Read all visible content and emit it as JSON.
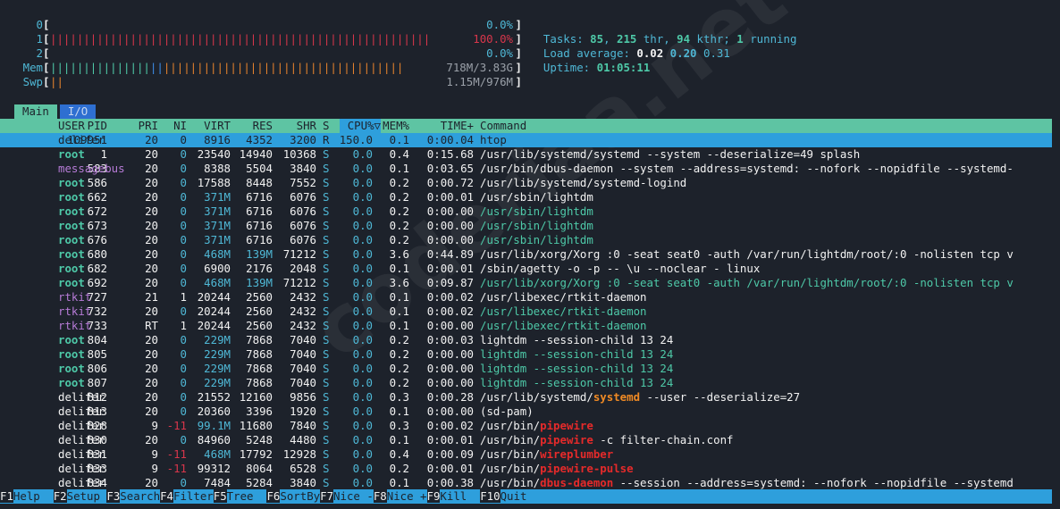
{
  "meters": [
    {
      "label": "0",
      "bars": "",
      "value": "0.0%",
      "value_color": "cyan"
    },
    {
      "label": "1",
      "bars": "|||||||||||||||||||||||||||||||||||||||||||||||||||||||||",
      "value": "100.0%",
      "value_color": "red",
      "bar_color": "#d8364b"
    },
    {
      "label": "2",
      "bars": "",
      "value": "0.0%",
      "value_color": "cyan"
    },
    {
      "label": "Mem",
      "bars": "||||||||||||||| ||||||||||||||||||||||||||||||||||||",
      "value": "718M/3.83G",
      "value_color": "gray",
      "bar_color": "#4ec9a8"
    },
    {
      "label": "Swp",
      "bars": "||",
      "value": "1.15M/976M",
      "value_color": "gray",
      "bar_color": "#e4822d"
    }
  ],
  "stats": {
    "tasks_label": "Tasks: ",
    "tasks": "85",
    "sep1": ", ",
    "thr": "215",
    "thr_label": " thr, ",
    "kthr": "94",
    "kthr_label": " kthr; ",
    "running": "1",
    "running_label": " running",
    "load_label": "Load average: ",
    "load1": "0.02",
    "load5": "0.20",
    "load15": "0.31",
    "uptime_label": "Uptime: ",
    "uptime": "01:05:11"
  },
  "tabs": {
    "main": "Main",
    "io": "I/O"
  },
  "columns": {
    "pid": "PID",
    "user": "USER",
    "pri": "PRI",
    "ni": "NI",
    "virt": "VIRT",
    "res": "RES",
    "shr": "SHR",
    "s": "S",
    "cpu": "CPU%▽",
    "mem": "MEM%",
    "time": "TIME+",
    "cmd": "Command"
  },
  "processes": [
    {
      "pid": "109951",
      "user": "delifer",
      "pri": "20",
      "ni": "0",
      "virt": "8916",
      "res": "4352",
      "shr": "3200",
      "s": "R",
      "cpu": "150.0",
      "mem": "0.1",
      "time": "0:00.04",
      "cmd": "htop",
      "selected": true
    },
    {
      "pid": "1",
      "user": "root",
      "pri": "20",
      "ni": "0",
      "virt": "23540",
      "res": "14940",
      "shr": "10368",
      "s": "S",
      "cpu": "0.0",
      "mem": "0.4",
      "time": "0:15.68",
      "cmd": "/usr/lib/systemd/systemd --system --deserialize=49 splash"
    },
    {
      "pid": "583",
      "user": "messagebus",
      "pri": "20",
      "ni": "0",
      "virt": "8388",
      "res": "5504",
      "shr": "3840",
      "s": "S",
      "cpu": "0.0",
      "mem": "0.1",
      "time": "0:03.65",
      "cmd": "/usr/bin/dbus-daemon --system --address=systemd: --nofork --nopidfile --systemd-"
    },
    {
      "pid": "586",
      "user": "root",
      "pri": "20",
      "ni": "0",
      "virt": "17588",
      "res": "8448",
      "shr": "7552",
      "s": "S",
      "cpu": "0.0",
      "mem": "0.2",
      "time": "0:00.72",
      "cmd": "/usr/lib/systemd/systemd-logind"
    },
    {
      "pid": "662",
      "user": "root",
      "pri": "20",
      "ni": "0",
      "virt": "371M",
      "res": "6716",
      "shr": "6076",
      "s": "S",
      "cpu": "0.0",
      "mem": "0.2",
      "time": "0:00.01",
      "cmd": "/usr/sbin/lightdm"
    },
    {
      "pid": "672",
      "user": "root",
      "pri": "20",
      "ni": "0",
      "virt": "371M",
      "res": "6716",
      "shr": "6076",
      "s": "S",
      "cpu": "0.0",
      "mem": "0.2",
      "time": "0:00.00",
      "cmd": "/usr/sbin/lightdm",
      "thread": true
    },
    {
      "pid": "673",
      "user": "root",
      "pri": "20",
      "ni": "0",
      "virt": "371M",
      "res": "6716",
      "shr": "6076",
      "s": "S",
      "cpu": "0.0",
      "mem": "0.2",
      "time": "0:00.00",
      "cmd": "/usr/sbin/lightdm",
      "thread": true
    },
    {
      "pid": "676",
      "user": "root",
      "pri": "20",
      "ni": "0",
      "virt": "371M",
      "res": "6716",
      "shr": "6076",
      "s": "S",
      "cpu": "0.0",
      "mem": "0.2",
      "time": "0:00.00",
      "cmd": "/usr/sbin/lightdm",
      "thread": true
    },
    {
      "pid": "680",
      "user": "root",
      "pri": "20",
      "ni": "0",
      "virt": "468M",
      "res": "139M",
      "shr": "71212",
      "s": "S",
      "cpu": "0.0",
      "mem": "3.6",
      "time": "0:44.89",
      "cmd": "/usr/lib/xorg/Xorg :0 -seat seat0 -auth /var/run/lightdm/root/:0 -nolisten tcp v"
    },
    {
      "pid": "682",
      "user": "root",
      "pri": "20",
      "ni": "0",
      "virt": "6900",
      "res": "2176",
      "shr": "2048",
      "s": "S",
      "cpu": "0.0",
      "mem": "0.1",
      "time": "0:00.01",
      "cmd": "/sbin/agetty -o -p -- \\u --noclear - linux"
    },
    {
      "pid": "692",
      "user": "root",
      "pri": "20",
      "ni": "0",
      "virt": "468M",
      "res": "139M",
      "shr": "71212",
      "s": "S",
      "cpu": "0.0",
      "mem": "3.6",
      "time": "0:09.87",
      "cmd": "/usr/lib/xorg/Xorg :0 -seat seat0 -auth /var/run/lightdm/root/:0 -nolisten tcp v",
      "thread": true
    },
    {
      "pid": "727",
      "user": "rtkit",
      "pri": "21",
      "ni": "1",
      "virt": "20244",
      "res": "2560",
      "shr": "2432",
      "s": "S",
      "cpu": "0.0",
      "mem": "0.1",
      "time": "0:00.02",
      "cmd": "/usr/libexec/rtkit-daemon"
    },
    {
      "pid": "732",
      "user": "rtkit",
      "pri": "20",
      "ni": "0",
      "virt": "20244",
      "res": "2560",
      "shr": "2432",
      "s": "S",
      "cpu": "0.0",
      "mem": "0.1",
      "time": "0:00.02",
      "cmd": "/usr/libexec/rtkit-daemon",
      "thread": true
    },
    {
      "pid": "733",
      "user": "rtkit",
      "pri": "RT",
      "ni": "1",
      "virt": "20244",
      "res": "2560",
      "shr": "2432",
      "s": "S",
      "cpu": "0.0",
      "mem": "0.1",
      "time": "0:00.00",
      "cmd": "/usr/libexec/rtkit-daemon",
      "thread": true
    },
    {
      "pid": "804",
      "user": "root",
      "pri": "20",
      "ni": "0",
      "virt": "229M",
      "res": "7868",
      "shr": "7040",
      "s": "S",
      "cpu": "0.0",
      "mem": "0.2",
      "time": "0:00.03",
      "cmd": "lightdm --session-child 13 24"
    },
    {
      "pid": "805",
      "user": "root",
      "pri": "20",
      "ni": "0",
      "virt": "229M",
      "res": "7868",
      "shr": "7040",
      "s": "S",
      "cpu": "0.0",
      "mem": "0.2",
      "time": "0:00.00",
      "cmd": "lightdm --session-child 13 24",
      "thread": true
    },
    {
      "pid": "806",
      "user": "root",
      "pri": "20",
      "ni": "0",
      "virt": "229M",
      "res": "7868",
      "shr": "7040",
      "s": "S",
      "cpu": "0.0",
      "mem": "0.2",
      "time": "0:00.00",
      "cmd": "lightdm --session-child 13 24",
      "thread": true
    },
    {
      "pid": "807",
      "user": "root",
      "pri": "20",
      "ni": "0",
      "virt": "229M",
      "res": "7868",
      "shr": "7040",
      "s": "S",
      "cpu": "0.0",
      "mem": "0.2",
      "time": "0:00.00",
      "cmd": "lightdm --session-child 13 24",
      "thread": true
    },
    {
      "pid": "812",
      "user": "delifer",
      "pri": "20",
      "ni": "0",
      "virt": "21552",
      "res": "12160",
      "shr": "9856",
      "s": "S",
      "cpu": "0.0",
      "mem": "0.3",
      "time": "0:00.28",
      "cmd_pre": "/usr/lib/systemd/",
      "cmd_hl": "systemd",
      "cmd_post": " --user --deserialize=27",
      "hl": "orange"
    },
    {
      "pid": "813",
      "user": "delifer",
      "pri": "20",
      "ni": "0",
      "virt": "20360",
      "res": "3396",
      "shr": "1920",
      "s": "S",
      "cpu": "0.0",
      "mem": "0.1",
      "time": "0:00.00",
      "cmd": "(sd-pam)"
    },
    {
      "pid": "828",
      "user": "delifer",
      "pri": "9",
      "ni": "-11",
      "virt": "99.1M",
      "res": "11680",
      "shr": "7840",
      "s": "S",
      "cpu": "0.0",
      "mem": "0.3",
      "time": "0:00.02",
      "cmd_pre": "/usr/bin/",
      "cmd_hl": "pipewire",
      "cmd_post": "",
      "hl": "red"
    },
    {
      "pid": "830",
      "user": "delifer",
      "pri": "20",
      "ni": "0",
      "virt": "84960",
      "res": "5248",
      "shr": "4480",
      "s": "S",
      "cpu": "0.0",
      "mem": "0.1",
      "time": "0:00.01",
      "cmd_pre": "/usr/bin/",
      "cmd_hl": "pipewire",
      "cmd_post": " -c filter-chain.conf",
      "hl": "red"
    },
    {
      "pid": "831",
      "user": "delifer",
      "pri": "9",
      "ni": "-11",
      "virt": "468M",
      "res": "17792",
      "shr": "12928",
      "s": "S",
      "cpu": "0.0",
      "mem": "0.4",
      "time": "0:00.09",
      "cmd_pre": "/usr/bin/",
      "cmd_hl": "wireplumber",
      "cmd_post": "",
      "hl": "red"
    },
    {
      "pid": "833",
      "user": "delifer",
      "pri": "9",
      "ni": "-11",
      "virt": "99312",
      "res": "8064",
      "shr": "6528",
      "s": "S",
      "cpu": "0.0",
      "mem": "0.2",
      "time": "0:00.01",
      "cmd_pre": "/usr/bin/",
      "cmd_hl": "pipewire-pulse",
      "cmd_post": "",
      "hl": "red"
    },
    {
      "pid": "834",
      "user": "delifer",
      "pri": "20",
      "ni": "0",
      "virt": "7484",
      "res": "5284",
      "shr": "3840",
      "s": "S",
      "cpu": "0.0",
      "mem": "0.1",
      "time": "0:00.38",
      "cmd_pre": "/usr/bin/",
      "cmd_hl": "dbus-daemon",
      "cmd_post": " --session --address=systemd: --nofork --nopidfile --systemd",
      "hl": "red"
    }
  ],
  "footer": [
    {
      "key": "F1",
      "label": "Help  "
    },
    {
      "key": "F2",
      "label": "Setup "
    },
    {
      "key": "F3",
      "label": "Search"
    },
    {
      "key": "F4",
      "label": "Filter"
    },
    {
      "key": "F5",
      "label": "Tree  "
    },
    {
      "key": "F6",
      "label": "SortBy"
    },
    {
      "key": "F7",
      "label": "Nice -"
    },
    {
      "key": "F8",
      "label": "Nice +"
    },
    {
      "key": "F9",
      "label": "Kill  "
    },
    {
      "key": "F10",
      "label": "Quit"
    }
  ],
  "watermark": "coderiaa.net",
  "colors": {
    "bg": "#1d222b",
    "header": "#5ec4a3",
    "selected": "#2e9fdc",
    "io_tab": "#2e6fd1"
  }
}
